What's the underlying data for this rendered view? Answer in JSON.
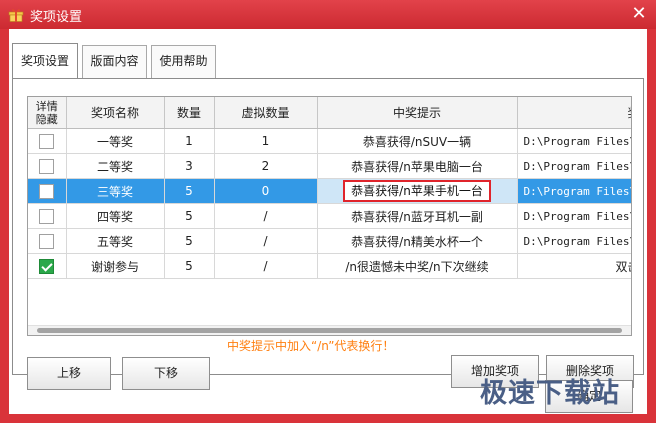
{
  "window": {
    "title": "奖项设置",
    "accent": "#d9333a"
  },
  "tabs": [
    {
      "label": "奖项设置",
      "active": true
    },
    {
      "label": "版面内容",
      "active": false
    },
    {
      "label": "使用帮助",
      "active": false
    }
  ],
  "table": {
    "headers": [
      "详情\n隐藏",
      "奖项名称",
      "数量",
      "虚拟数量",
      "中奖提示",
      "奖品图"
    ],
    "rows": [
      {
        "checked": false,
        "name": "一等奖",
        "qty": "1",
        "vqty": "1",
        "tip": "恭喜获得/nSUV一辆",
        "img": "D:\\Program Files\\J"
      },
      {
        "checked": false,
        "name": "二等奖",
        "qty": "3",
        "vqty": "2",
        "tip": "恭喜获得/n苹果电脑一台",
        "img": "D:\\Program Files\\J"
      },
      {
        "checked": false,
        "name": "三等奖",
        "qty": "5",
        "vqty": "0",
        "tip": "恭喜获得/n苹果手机一台",
        "img": "D:\\Program Files\\J",
        "selected": true
      },
      {
        "checked": false,
        "name": "四等奖",
        "qty": "5",
        "vqty": "/",
        "tip": "恭喜获得/n蓝牙耳机一副",
        "img": "D:\\Program Files\\J"
      },
      {
        "checked": false,
        "name": "五等奖",
        "qty": "5",
        "vqty": "/",
        "tip": "恭喜获得/n精美水杯一个",
        "img": "D:\\Program Files\\J"
      },
      {
        "checked": true,
        "name": "谢谢参与",
        "qty": "5",
        "vqty": "/",
        "tip": "/n很遗憾未中奖/n下次继续",
        "img": "双击选择"
      }
    ]
  },
  "buttons": {
    "move_up": "上移",
    "move_down": "下移",
    "add": "增加奖项",
    "delete": "删除奖项",
    "ok": "确定"
  },
  "hint": "中奖提示中加入“/n”代表换行！",
  "watermark": "极速下载站"
}
